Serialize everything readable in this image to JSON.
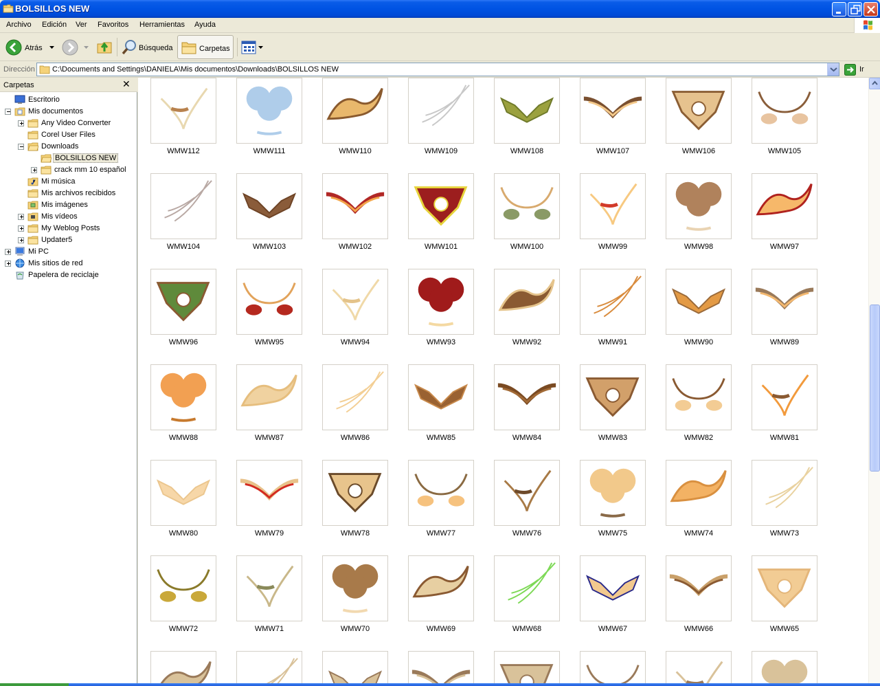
{
  "window": {
    "title": "BOLSILLOS NEW",
    "controls": [
      "minimize-icon",
      "restore-icon",
      "close-icon"
    ]
  },
  "menu": [
    "Archivo",
    "Edición",
    "Ver",
    "Favoritos",
    "Herramientas",
    "Ayuda"
  ],
  "toolbar": {
    "back_label": "Atrás",
    "search_label": "Búsqueda",
    "folders_label": "Carpetas"
  },
  "address": {
    "label": "Dirección",
    "path": "C:\\Documents and Settings\\DANIELA\\Mis documentos\\Downloads\\BOLSILLOS NEW",
    "go_label": "Ir"
  },
  "folder_pane": {
    "title": "Carpetas",
    "tree": [
      {
        "label": "Escritorio",
        "icon": "desktop-icon",
        "expander": "",
        "selected": false
      },
      {
        "label": "Mis documentos",
        "icon": "my-documents-icon",
        "expander": "minus",
        "selected": false
      },
      {
        "label": "Any Video Converter",
        "icon": "folder-icon",
        "expander": "plus",
        "selected": false
      },
      {
        "label": "Corel User Files",
        "icon": "folder-icon",
        "expander": "",
        "selected": false
      },
      {
        "label": "Downloads",
        "icon": "folder-open-icon",
        "expander": "minus",
        "selected": false
      },
      {
        "label": "BOLSILLOS NEW",
        "icon": "folder-open-icon",
        "expander": "",
        "selected": true
      },
      {
        "label": "crack mm 10 español",
        "icon": "folder-icon",
        "expander": "plus",
        "selected": false
      },
      {
        "label": "Mi música",
        "icon": "music-folder-icon",
        "expander": "",
        "selected": false
      },
      {
        "label": "Mis archivos recibidos",
        "icon": "folder-icon",
        "expander": "",
        "selected": false
      },
      {
        "label": "Mis imágenes",
        "icon": "pictures-folder-icon",
        "expander": "",
        "selected": false
      },
      {
        "label": "Mis vídeos",
        "icon": "videos-folder-icon",
        "expander": "plus",
        "selected": false
      },
      {
        "label": "My Weblog Posts",
        "icon": "folder-icon",
        "expander": "plus",
        "selected": false
      },
      {
        "label": "Updater5",
        "icon": "folder-icon",
        "expander": "plus",
        "selected": false
      },
      {
        "label": "Mi PC",
        "icon": "my-computer-icon",
        "expander": "plus",
        "selected": false
      },
      {
        "label": "Mis sitios de red",
        "icon": "network-places-icon",
        "expander": "plus",
        "selected": false
      },
      {
        "label": "Papelera de reciclaje",
        "icon": "recycle-bin-icon",
        "expander": "",
        "selected": false
      }
    ]
  },
  "files": [
    "WMW112",
    "WMW111",
    "WMW110",
    "WMW109",
    "WMW108",
    "WMW107",
    "WMW106",
    "WMW105",
    "WMW104",
    "WMW103",
    "WMW102",
    "WMW101",
    "WMW100",
    "WMW99",
    "WMW98",
    "WMW97",
    "WMW96",
    "WMW95",
    "WMW94",
    "WMW93",
    "WMW92",
    "WMW91",
    "WMW90",
    "WMW89",
    "WMW88",
    "WMW87",
    "WMW86",
    "WMW85",
    "WMW84",
    "WMW83",
    "WMW82",
    "WMW81",
    "WMW80",
    "WMW79",
    "WMW78",
    "WMW77",
    "WMW76",
    "WMW75",
    "WMW74",
    "WMW73",
    "WMW72",
    "WMW71",
    "WMW70",
    "WMW69",
    "WMW68",
    "WMW67",
    "WMW66",
    "WMW65",
    "",
    "",
    "",
    "",
    "",
    "",
    "",
    ""
  ],
  "thumb_palette": {
    "WMW112": [
      "#E8D8B0",
      "#B8824E"
    ],
    "WMW111": [
      "#AFCDEA",
      "#AFCDEA"
    ],
    "WMW110": [
      "#E9B86C",
      "#8A5A2E"
    ],
    "WMW109": [
      "#C8C8C8",
      "#D1A238"
    ],
    "WMW108": [
      "#9BA13F",
      "#6F7A2A"
    ],
    "WMW107": [
      "#F4C98B",
      "#7A5030"
    ],
    "WMW106": [
      "#E6C28E",
      "#8B5E34"
    ],
    "WMW105": [
      "#E8C4A0",
      "#8A5E3A"
    ],
    "WMW104": [
      "#B9A9A4",
      "#8A3830"
    ],
    "WMW103": [
      "#8A5C3A",
      "#6E4426"
    ],
    "WMW102": [
      "#F3A64B",
      "#B12826"
    ],
    "WMW101": [
      "#9C1E1E",
      "#E6D33B"
    ],
    "WMW100": [
      "#8A9A66",
      "#D8AA6E"
    ],
    "WMW99": [
      "#F7C981",
      "#D23A2A"
    ],
    "WMW98": [
      "#B0825C",
      "#E9D3B2"
    ],
    "WMW97": [
      "#F6B86A",
      "#B0221E"
    ],
    "WMW96": [
      "#5F8A3B",
      "#8A5A32"
    ],
    "WMW95": [
      "#B5291F",
      "#E2A35B"
    ],
    "WMW94": [
      "#F0D9A8",
      "#E4C38A"
    ],
    "WMW93": [
      "#A01B1B",
      "#F4D9A2"
    ],
    "WMW92": [
      "#8A5A32",
      "#E5C48C"
    ],
    "WMW91": [
      "#D98C3E",
      "#8A5A32"
    ],
    "WMW90": [
      "#E39A45",
      "#9A6A3A"
    ],
    "WMW89": [
      "#F4B970",
      "#9A7A5A"
    ],
    "WMW88": [
      "#F2A052",
      "#C77A2E"
    ],
    "WMW87": [
      "#F0D2A0",
      "#E6BE7E"
    ],
    "WMW86": [
      "#F3CF95",
      "#9A6A32"
    ],
    "WMW85": [
      "#9A6232",
      "#C88A4C"
    ],
    "WMW84": [
      "#A26A36",
      "#7A4A22"
    ],
    "WMW83": [
      "#D2A06A",
      "#8A5A32"
    ],
    "WMW82": [
      "#F3CC94",
      "#8A5A32"
    ],
    "WMW81": [
      "#F29A3C",
      "#8A5A32"
    ],
    "WMW80": [
      "#F7D7A8",
      "#EBC68E"
    ],
    "WMW79": [
      "#D32A20",
      "#E8C28A"
    ],
    "WMW78": [
      "#E8C48C",
      "#6A4A2A"
    ],
    "WMW77": [
      "#F6C27E",
      "#8A6A42"
    ],
    "WMW76": [
      "#A87A46",
      "#6E4A2A"
    ],
    "WMW75": [
      "#F2C98B",
      "#8A6A48"
    ],
    "WMW74": [
      "#F3B264",
      "#D99040"
    ],
    "WMW73": [
      "#E9D2A0",
      "#8F8A2E"
    ],
    "WMW72": [
      "#C9A83A",
      "#8A7A2A"
    ],
    "WMW71": [
      "#C9B88A",
      "#8A8A5A"
    ],
    "WMW70": [
      "#A87A4A",
      "#F2D9B0"
    ],
    "WMW69": [
      "#E7CFA2",
      "#8A5A32"
    ],
    "WMW68": [
      "#7ED957",
      "#5A3A7A"
    ],
    "WMW67": [
      "#F2C98E",
      "#2A2A8A"
    ],
    "WMW66": [
      "#8A5A32",
      "#C9A06A"
    ],
    "WMW65": [
      "#F2CC94",
      "#E4B67A"
    ]
  }
}
